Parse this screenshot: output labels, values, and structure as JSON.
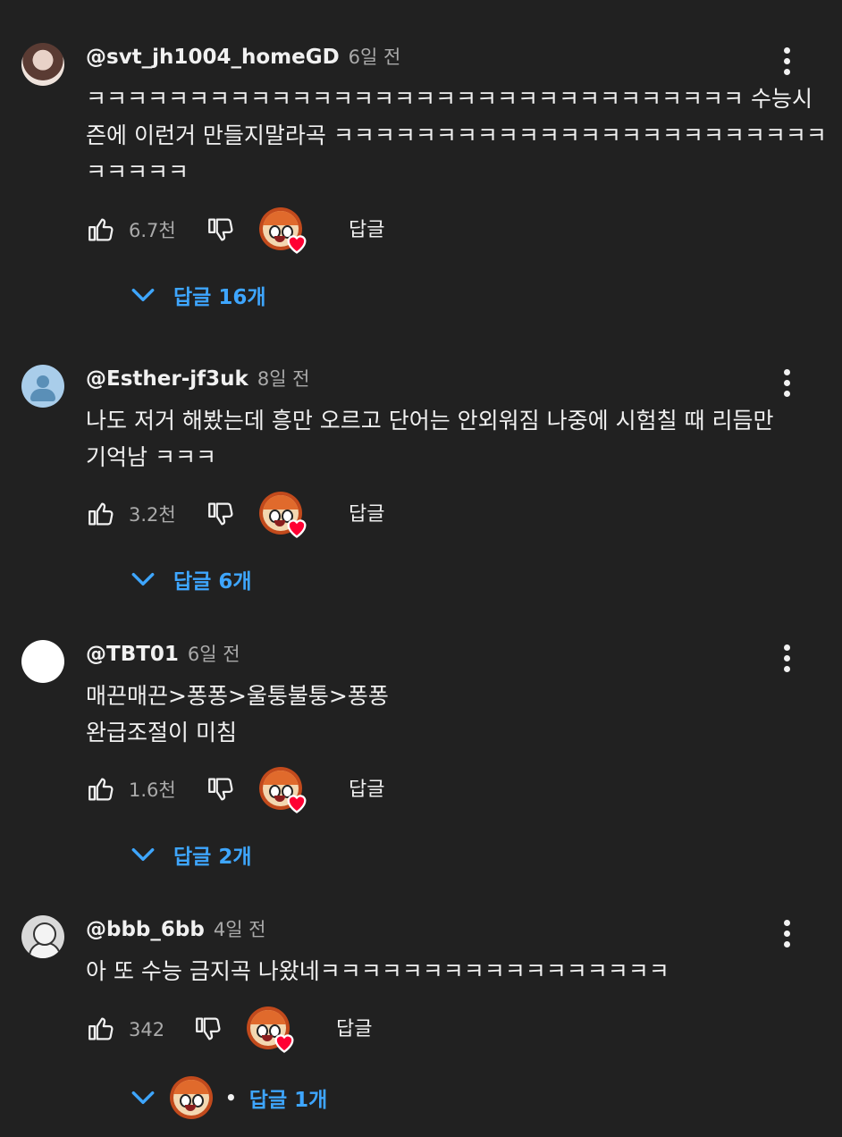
{
  "comments": [
    {
      "author": "@svt_jh1004_homeGD",
      "time": "6일 전",
      "text": "ㅋㅋㅋㅋㅋㅋㅋㅋㅋㅋㅋㅋㅋㅋㅋㅋㅋㅋㅋㅋㅋㅋㅋㅋㅋㅋㅋㅋㅋㅋㅋㅋ 수능시\n즌에 이런거 만들지말라곡 ㅋㅋㅋㅋㅋㅋㅋㅋㅋㅋㅋㅋㅋㅋㅋㅋㅋㅋㅋㅋㅋㅋㅋㅋ\nㅋㅋㅋㅋㅋ",
      "likes": "6.7천",
      "reply_label": "답글",
      "replies_label": "답글 16개"
    },
    {
      "author": "@Esther-jf3uk",
      "time": "8일 전",
      "text": "나도 저거 해봤는데 흥만 오르고 단어는 안외워짐 나중에 시험칠 때 리듬만\n기억남 ㅋㅋㅋ",
      "likes": "3.2천",
      "reply_label": "답글",
      "replies_label": "답글 6개"
    },
    {
      "author": "@TBT01",
      "time": "6일 전",
      "text": "매끈매끈>퐁퐁>울퉁불퉁>퐁퐁\n완급조절이 미침",
      "likes": "1.6천",
      "reply_label": "답글",
      "replies_label": "답글 2개"
    },
    {
      "author": "@bbb_6bb",
      "time": "4일 전",
      "text": "아 또 수능 금지곡 나왔네ㅋㅋㅋㅋㅋㅋㅋㅋㅋㅋㅋㅋㅋㅋㅋㅋㅋ",
      "likes": "342",
      "reply_label": "답글",
      "replies_label": "답글 1개",
      "replies_separator": "•"
    }
  ],
  "colors": {
    "background": "#212121",
    "text": "#f1f1f1",
    "secondary": "#aaaaaa",
    "link": "#3ea6ff",
    "heart": "#ff0033"
  },
  "icons": [
    "thumbs-up-icon",
    "thumbs-down-icon",
    "more-vert-icon",
    "chevron-down-icon",
    "heart-icon"
  ]
}
